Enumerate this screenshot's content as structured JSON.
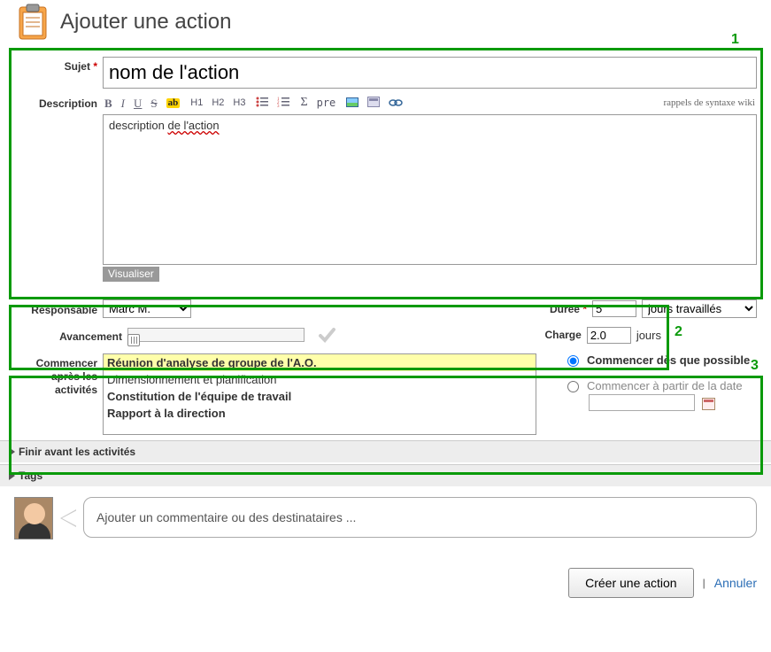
{
  "header": {
    "title": "Ajouter une action"
  },
  "s1": {
    "subject_label": "Sujet",
    "subject_value": "nom de l'action",
    "desc_label": "Description",
    "tb": {
      "b": "B",
      "i": "I",
      "u": "U",
      "s": "S",
      "ab": "ab",
      "h1": "H1",
      "h2": "H2",
      "h3": "H3",
      "sum": "Σ",
      "pre": "pre"
    },
    "wiki_hint": "rappels de syntaxe wiki",
    "desc_value_pre": "description ",
    "desc_value_err": "de l'action",
    "visualize": "Visualiser"
  },
  "s2": {
    "resp_label": "Responsable",
    "resp_value": "Marc M.",
    "duree_label": "Durée",
    "duree_value": "5",
    "duree_unit": "jours travaillés",
    "adv_label": "Avancement",
    "charge_label": "Charge",
    "charge_value": "2.0",
    "charge_unit": "jours"
  },
  "s3": {
    "after_label": "Commencer après les activités",
    "items": [
      "Réunion d'analyse de groupe de l'A.O.",
      "Dimensionnement et planification",
      "Constitution de l'équipe de travail",
      "Rapport à la direction"
    ],
    "asap": "Commencer dès que possible",
    "fromdate": "Commencer à partir de la date"
  },
  "coll": {
    "finish": "Finir avant les activités",
    "tags": "Tags"
  },
  "comment": {
    "placeholder": "Ajouter un commentaire ou des destinataires ..."
  },
  "footer": {
    "create": "Créer une action",
    "cancel": "Annuler"
  },
  "annot": {
    "n1": "1",
    "n2": "2",
    "n3": "3"
  }
}
